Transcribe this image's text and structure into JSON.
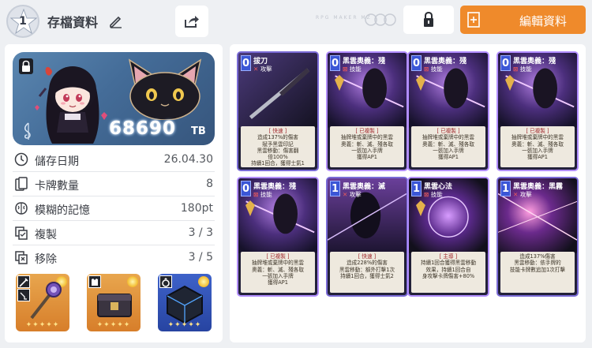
{
  "header": {
    "rank": "1",
    "title": "存檔資料",
    "brand_text": "RPG MAKER MZ",
    "edit_button_label": "編輯資料"
  },
  "profile": {
    "money": "68690",
    "money_unit": "TB"
  },
  "stats": [
    {
      "label": "儲存日期",
      "value": "26.04.30",
      "icon": "clock-icon"
    },
    {
      "label": "卡牌數量",
      "value": "8",
      "icon": "cards-icon"
    },
    {
      "label": "模糊的記憶",
      "value": "180pt",
      "icon": "brain-icon"
    },
    {
      "label": "複製",
      "value": "3 / 3",
      "icon": "copy-icon"
    },
    {
      "label": "移除",
      "value": "3 / 5",
      "icon": "remove-icon"
    }
  ],
  "equipment": [
    {
      "name": "weapon",
      "stars": "✦✦✦✦✦",
      "rarity_color": "#e8a64e"
    },
    {
      "name": "armor",
      "stars": "✦✦✦✦✦",
      "rarity_color": "#e8a64e"
    },
    {
      "name": "accessory",
      "stars": "✦✦✦✦✦",
      "rarity_color": "#3e62c9"
    }
  ],
  "cards": [
    {
      "cost": "0",
      "name": "拔刀",
      "type": "攻擊",
      "tag": "[ 快速 ]",
      "text": "造成137%的傷害\n賦予黑雲印記\n黑雲移動：傷害翻\n倍100%\n持續1回合，獲得士氣1"
    },
    {
      "cost": "0",
      "name": "黑雲奧義：殘",
      "type": "技能",
      "tag": "[ 已複製 ]",
      "text": "抽牌堆或棄牌中的黑雲\n奧義：斬、滅、殘各取\n一張加入手牌\n獲得AP1"
    },
    {
      "cost": "0",
      "name": "黑雲奧義：殘",
      "type": "技能",
      "tag": "[ 已複製 ]",
      "text": "抽牌堆或棄牌中的黑雲\n奧義：斬、滅、殘各取\n一張加入手牌\n獲得AP1"
    },
    {
      "cost": "0",
      "name": "黑雲奧義：殘",
      "type": "技能",
      "tag": "[ 已複製 ]",
      "text": "抽牌堆或棄牌中的黑雲\n奧義：斬、滅、殘各取\n一張加入手牌\n獲得AP1"
    },
    {
      "cost": "0",
      "name": "黑雲奧義：殘",
      "type": "技能",
      "tag": "[ 已複製 ]",
      "text": "抽牌堆或棄牌中的黑雲\n奧義：斬、滅、殘各取\n一張加入手牌\n獲得AP1"
    },
    {
      "cost": "1",
      "name": "黑雲奧義：滅",
      "type": "攻擊",
      "tag": "[ 快速 ]",
      "text": "造成228%的傷害\n黑雲移動：額外打擊1次\n持續1回合，獲得士氣2"
    },
    {
      "cost": "1",
      "name": "黑雲心法",
      "type": "技能",
      "tag": "[ 主導 ]",
      "text": "持續1回合獲得黑雲移動\n效果，持續1回合自\n身攻擊卡牌傷害+80%"
    },
    {
      "cost": "1",
      "name": "黑雲奧義：黑霧",
      "type": "攻擊",
      "tag": "",
      "text": "造成137%傷害\n黑雲移動：依手牌的\n技能卡牌數追加1次打擊"
    }
  ],
  "colors": {
    "accent_orange": "#ef8a2b",
    "card_border": "#7a6bd6",
    "card_cost": "#3b56d6"
  }
}
